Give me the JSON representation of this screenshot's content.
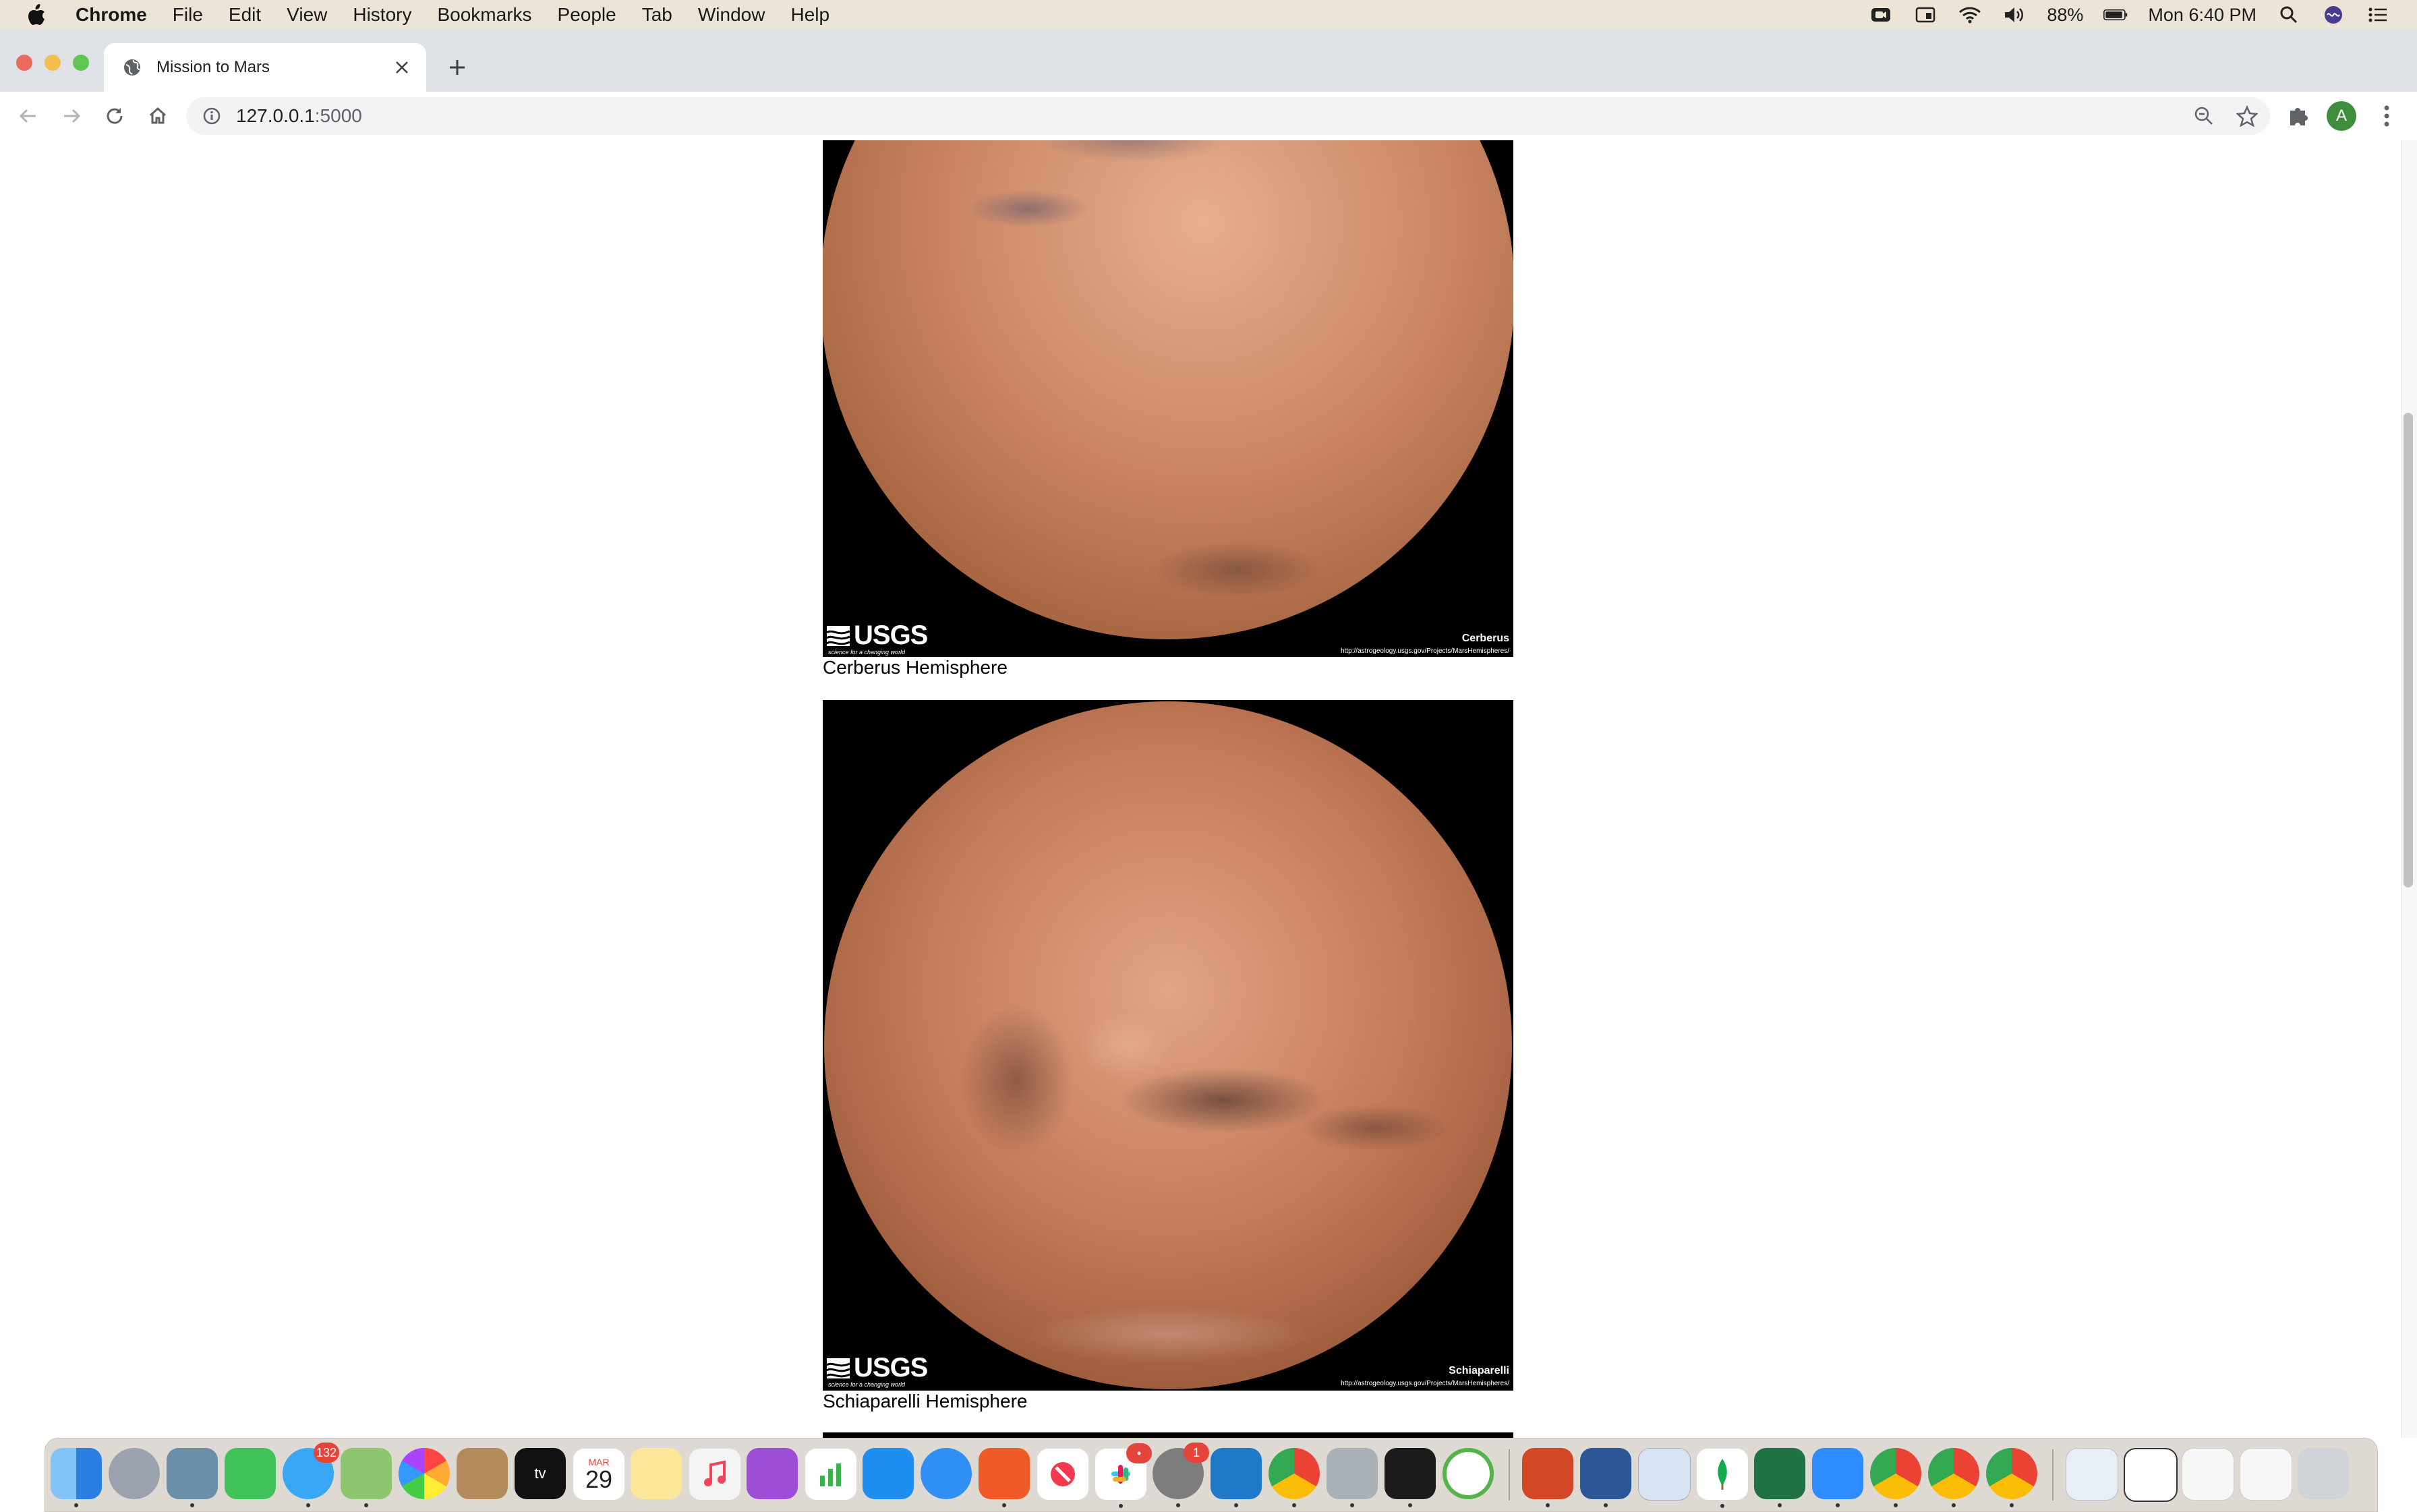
{
  "menubar": {
    "app_name": "Chrome",
    "menus": [
      "File",
      "Edit",
      "View",
      "History",
      "Bookmarks",
      "People",
      "Tab",
      "Window",
      "Help"
    ],
    "battery": "88%",
    "clock": "Mon 6:40 PM"
  },
  "browser": {
    "tab_title": "Mission to Mars",
    "url_host": "127.0.0.1",
    "url_port": ":5000",
    "profile_initial": "A"
  },
  "hemispheres": [
    {
      "image_name": "Cerberus",
      "image_url": "http://astrogeology.usgs.gov/Projects/MarsHemispheres/",
      "caption": "Cerberus Hemisphere"
    },
    {
      "image_name": "Schiaparelli",
      "image_url": "http://astrogeology.usgs.gov/Projects/MarsHemispheres/",
      "caption": "Schiaparelli Hemisphere"
    }
  ],
  "image_branding": {
    "logo": "USGS",
    "tagline": "science for a changing world"
  },
  "dock": {
    "messages_badge": "132",
    "slack_badge": "•",
    "sysprefs_badge": "1",
    "calendar_month": "MAR",
    "calendar_day": "29",
    "tv_label": "tv"
  },
  "colors": {
    "mars_light": "#e0a07c",
    "mars_mid": "#b9714d",
    "mars_dark": "#7a4632"
  }
}
